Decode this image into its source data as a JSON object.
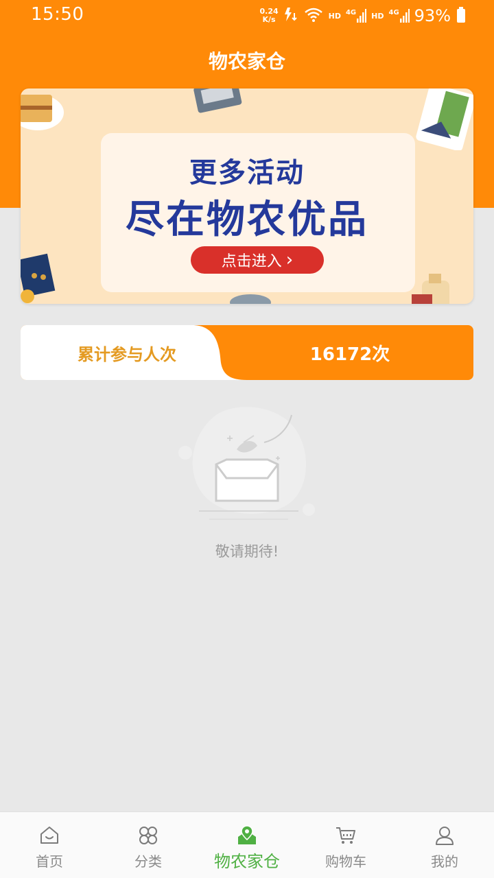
{
  "status_bar": {
    "time": "15:50",
    "net_speed_value": "0.24",
    "net_speed_unit": "K/s",
    "hd_1": "HD",
    "net_1": "4G",
    "hd_2": "HD",
    "net_2": "4G",
    "battery": "93%"
  },
  "header": {
    "title": "物农家仓"
  },
  "banner": {
    "line1": "更多活动",
    "line2": "尽在物农优品",
    "button_label": "点击进入",
    "button_arrow": "›"
  },
  "stats": {
    "label": "累计参与人次",
    "value": "16172次"
  },
  "empty_state": {
    "text": "敬请期待!"
  },
  "bottom_nav": {
    "items": [
      {
        "label": "首页",
        "icon": "home-icon",
        "active": false
      },
      {
        "label": "分类",
        "icon": "category-icon",
        "active": false
      },
      {
        "label": "物农家仓",
        "icon": "warehouse-location-icon",
        "active": true
      },
      {
        "label": "购物车",
        "icon": "cart-icon",
        "active": false
      },
      {
        "label": "我的",
        "icon": "user-icon",
        "active": false
      }
    ]
  },
  "colors": {
    "header": "#ff8a08",
    "banner_text": "#24399b",
    "banner_button": "#d9302a",
    "stats_label": "#e49a21",
    "nav_active": "#4fb043",
    "nav_inactive": "#8a8a8a"
  }
}
